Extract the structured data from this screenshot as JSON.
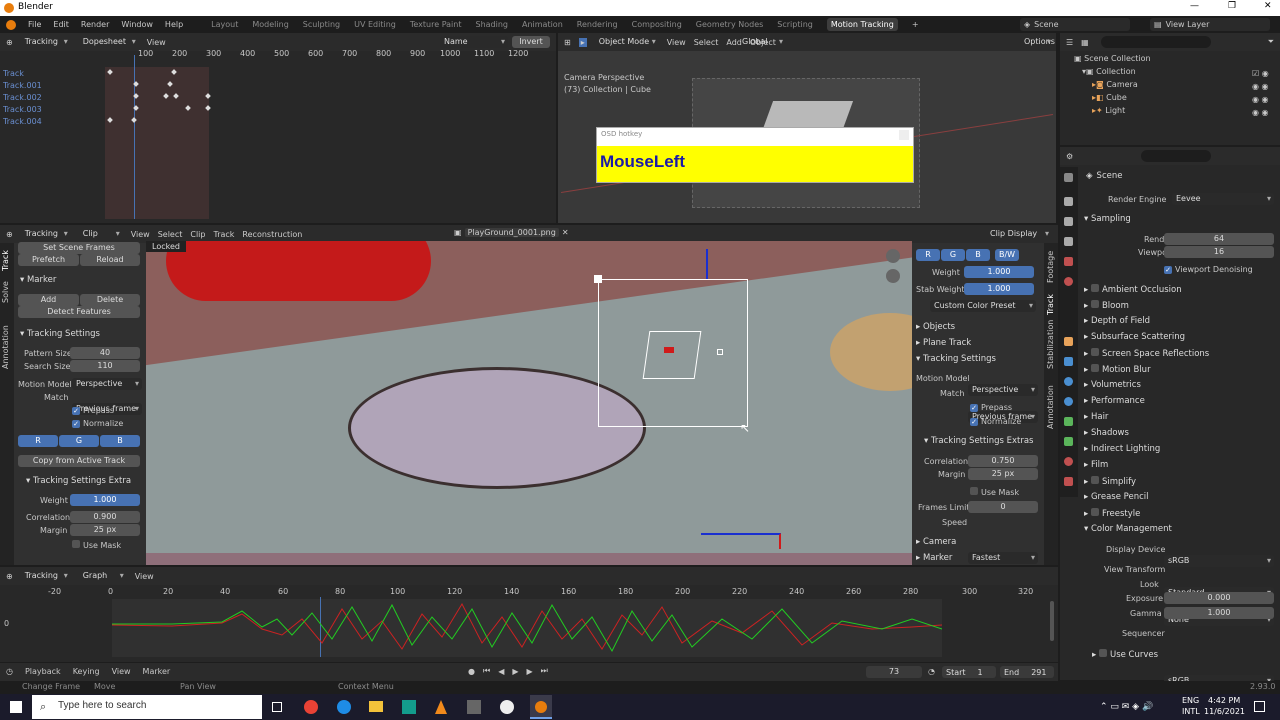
{
  "title_bar": {
    "app": "Blender",
    "controls": [
      "—",
      "❐",
      "✕"
    ]
  },
  "menu": {
    "items": [
      "File",
      "Edit",
      "Render",
      "Window",
      "Help"
    ]
  },
  "workspaces": [
    "Layout",
    "Modeling",
    "Sculpting",
    "UV Editing",
    "Texture Paint",
    "Shading",
    "Animation",
    "Rendering",
    "Compositing",
    "Geometry Nodes",
    "Scripting",
    "Motion Tracking"
  ],
  "workspace_active": "Motion Tracking",
  "top_right": {
    "scene": "Scene",
    "view_layer": "View Layer"
  },
  "dopesheet": {
    "mode": "Tracking",
    "type": "Dopesheet",
    "view": "View",
    "sort": "Name",
    "invert": "Invert",
    "ticks": [
      "100",
      "200",
      "300",
      "400",
      "500",
      "600",
      "700",
      "800",
      "900",
      "1000",
      "1100",
      "1200"
    ],
    "tracks": [
      "Track",
      "Track.001",
      "Track.002",
      "Track.003",
      "Track.004"
    ]
  },
  "viewport3d": {
    "mode": "Object Mode",
    "menu": [
      "View",
      "Select",
      "Add",
      "Object"
    ],
    "orientation": "Global",
    "options": "Options",
    "cam_label": "Camera Perspective",
    "collection_label": "(73) Collection | Cube",
    "osd_title": "OSD hotkey",
    "osd_text": "MouseLeft"
  },
  "outliner": {
    "scene_collection": "Scene Collection",
    "items": [
      "Collection",
      "Camera",
      "Cube",
      "Light"
    ]
  },
  "clip_editor": {
    "mode": "Tracking",
    "type": "Clip",
    "menu": [
      "View",
      "Select",
      "Clip",
      "Track",
      "Reconstruction"
    ],
    "file": "PlayGround_0001.png",
    "display": "Clip Display",
    "locked": "Locked"
  },
  "left_panel": {
    "tabs": [
      "Track",
      "Solve",
      "Annotation"
    ],
    "set_scene_frames": "Set Scene Frames",
    "prefetch": "Prefetch",
    "reload": "Reload",
    "marker": "Marker",
    "add": "Add",
    "delete": "Delete",
    "detect": "Detect Features",
    "tracking_settings": "Tracking Settings",
    "pattern_size_lbl": "Pattern Size",
    "pattern_size": "40",
    "search_size_lbl": "Search Size",
    "search_size": "110",
    "motion_model_lbl": "Motion Model",
    "motion_model": "Perspective",
    "match_lbl": "Match",
    "match": "Previous frame",
    "prepass": "Prepass",
    "normalize": "Normalize",
    "rgb": [
      "R",
      "G",
      "B"
    ],
    "copy_from": "Copy from Active Track",
    "extras": "Tracking Settings Extra",
    "weight_lbl": "Weight",
    "weight": "1.000",
    "correlation_lbl": "Correlation",
    "correlation": "0.900",
    "margin_lbl": "Margin",
    "margin": "25 px",
    "use_mask": "Use Mask"
  },
  "right_clip_panel": {
    "tabs": [
      "Footage",
      "Track",
      "Stabilization",
      "Annotation"
    ],
    "channels": [
      "R",
      "G",
      "B",
      "B/W"
    ],
    "weight_lbl": "Weight",
    "weight": "1.000",
    "stab_weight_lbl": "Stab Weight",
    "stab_weight": "1.000",
    "preset": "Custom Color Preset",
    "objects": "Objects",
    "plane_track": "Plane Track",
    "tracking_settings": "Tracking Settings",
    "motion_model_lbl": "Motion Model",
    "motion_model": "Perspective",
    "match_lbl": "Match",
    "match": "Previous frame",
    "prepass": "Prepass",
    "normalize": "Normalize",
    "extras": "Tracking Settings Extras",
    "correlation_lbl": "Correlation",
    "correlation": "0.750",
    "margin_lbl": "Margin",
    "margin": "25 px",
    "use_mask": "Use Mask",
    "frames_limit_lbl": "Frames Limit",
    "frames_limit": "0",
    "speed_lbl": "Speed",
    "speed": "Fastest",
    "camera": "Camera",
    "marker": "Marker"
  },
  "properties": {
    "scene": "Scene",
    "render_engine_lbl": "Render Engine",
    "render_engine": "Eevee",
    "sampling": "Sampling",
    "render_lbl": "Render",
    "render": "64",
    "viewport_lbl": "Viewport",
    "viewport": "16",
    "viewport_denoise": "Viewport Denoising",
    "sections": [
      "Ambient Occlusion",
      "Bloom",
      "Depth of Field",
      "Subsurface Scattering",
      "Screen Space Reflections",
      "Motion Blur",
      "Volumetrics",
      "Performance",
      "Hair",
      "Shadows",
      "Indirect Lighting",
      "Film",
      "Simplify",
      "Grease Pencil",
      "Freestyle",
      "Color Management"
    ],
    "display_device_lbl": "Display Device",
    "display_device": "sRGB",
    "view_transform_lbl": "View Transform",
    "view_transform": "Standard",
    "look_lbl": "Look",
    "look": "None",
    "exposure_lbl": "Exposure",
    "exposure": "0.000",
    "gamma_lbl": "Gamma",
    "gamma": "1.000",
    "sequencer_lbl": "Sequencer",
    "sequencer": "sRGB",
    "use_curves": "Use Curves"
  },
  "graph": {
    "mode": "Tracking",
    "type": "Graph",
    "view": "View",
    "ticks": [
      "-20",
      "0",
      "20",
      "40",
      "60",
      "80",
      "100",
      "120",
      "140",
      "160",
      "180",
      "200",
      "220",
      "240",
      "260",
      "280",
      "300",
      "320"
    ],
    "y_zero": "0"
  },
  "timeline": {
    "menu": [
      "Playback",
      "Keying",
      "View",
      "Marker"
    ],
    "frame": "73",
    "start_lbl": "Start",
    "start": "1",
    "end_lbl": "End",
    "end": "291"
  },
  "status": {
    "change_frame": "Change Frame",
    "move": "Move",
    "pan_view": "Pan View",
    "context_menu": "Context Menu",
    "version": "2.93.0"
  },
  "taskbar": {
    "search": "Type here to search",
    "lang": "ENG",
    "region": "INTL",
    "time": "4:42 PM",
    "date": "11/6/2021"
  },
  "colors": {
    "accent": "#4772b3",
    "active_ws": "#3d3d3d",
    "osd_yellow": "#ffff00",
    "osd_text": "#1a1aa8"
  }
}
